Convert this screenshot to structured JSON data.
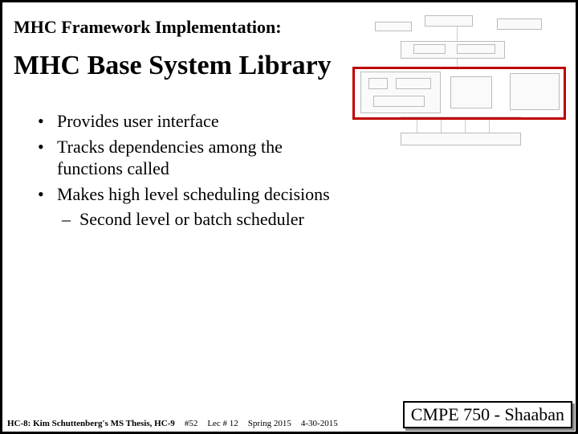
{
  "header": {
    "subtitle": "MHC Framework Implementation:",
    "title": "MHC Base System Library"
  },
  "bullets": [
    {
      "text": "Provides user interface"
    },
    {
      "text": "Tracks dependencies among the functions called"
    },
    {
      "text": "Makes high level scheduling decisions",
      "sub": [
        "Second level or batch scheduler"
      ]
    }
  ],
  "diagram": {
    "caption_hint": "system block diagram (small, illegible)",
    "highlight_region": "middle band"
  },
  "footer": {
    "source": "HC-8: Kim Schuttenberg's MS Thesis, HC-9",
    "page": "#52",
    "lecture": "Lec # 12",
    "term": "Spring 2015",
    "date": "4-30-2015",
    "course": "CMPE 750 - Shaaban"
  }
}
